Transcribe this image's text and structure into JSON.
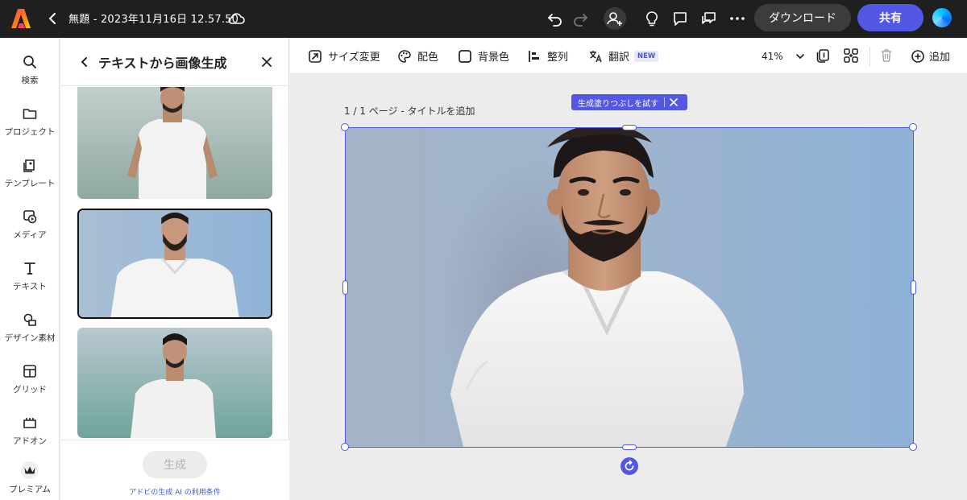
{
  "app": {
    "document_title": "無題 - 2023年11月16日 12.57.50",
    "download_label": "ダウンロード",
    "share_label": "共有"
  },
  "rail": {
    "items": [
      {
        "label": "検索",
        "icon": "search-icon"
      },
      {
        "label": "プロジェクト",
        "icon": "folder-icon"
      },
      {
        "label": "テンプレート",
        "icon": "template-icon"
      },
      {
        "label": "メディア",
        "icon": "media-icon"
      },
      {
        "label": "テキスト",
        "icon": "text-icon"
      },
      {
        "label": "デザイン素材",
        "icon": "shapes-icon"
      },
      {
        "label": "グリッド",
        "icon": "grid-icon"
      },
      {
        "label": "アドオン",
        "icon": "addon-icon"
      },
      {
        "label": "プレミアム",
        "icon": "premium-crown-icon"
      }
    ]
  },
  "panel": {
    "title": "テキストから画像生成",
    "generate_label": "生成",
    "terms_label": "アドビの生成 AI の利用条件"
  },
  "toolbar": {
    "resize_label": "サイズ変更",
    "color_label": "配色",
    "background_label": "背景色",
    "align_label": "整列",
    "translate_label": "翻訳",
    "new_badge": "NEW",
    "zoom_label": "41%",
    "add_label": "追加"
  },
  "canvas": {
    "page_label": "1 / 1 ページ - タイトルを追加",
    "fill_tip_label": "生成塗りつぶしを試す"
  },
  "colors": {
    "accent": "#5258e4",
    "topbar": "#1f1f1f"
  }
}
